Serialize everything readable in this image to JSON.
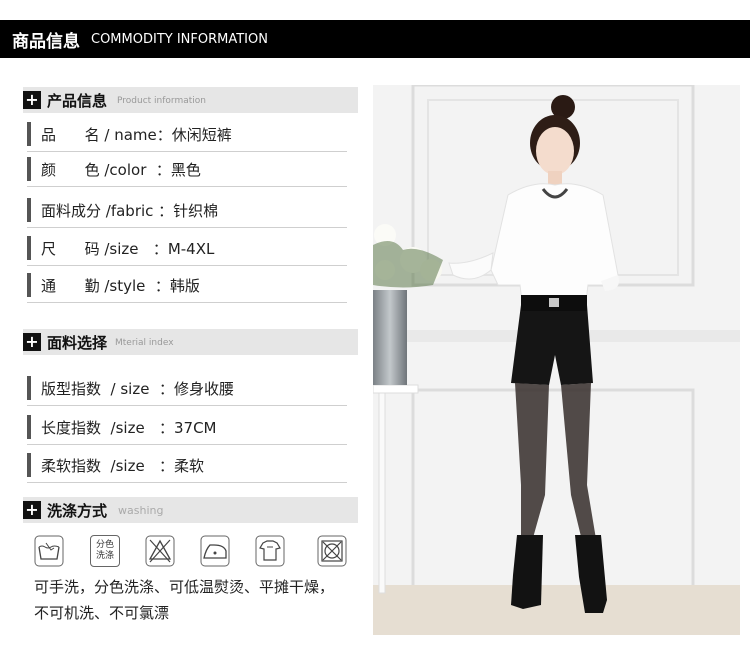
{
  "header": {
    "title_cn": "商品信息",
    "title_en": "COMMODITY INFORMATION"
  },
  "product_info": {
    "title": "产品信息",
    "subtitle": "Product information",
    "rows": [
      "品      名 / name：休闲短裤",
      "颜      色 /color  ：黑色",
      "面料成分 /fabric ：针织棉",
      "尺      码 /size   ：M-4XL",
      "通      勤 /style  ：韩版"
    ]
  },
  "material": {
    "title": "面料选择",
    "subtitle": "Mterial index",
    "rows": [
      "版型指数  / size  ：修身收腰",
      "长度指数  /size   ：37CM",
      "柔软指数  /size   ：柔软"
    ]
  },
  "washing": {
    "title": "洗涤方式",
    "subtitle": "washing",
    "icon_text_line1": "分色",
    "icon_text_line2": "洗涤",
    "desc_line1": "可手洗，分色洗涤、可低温熨烫、平摊干燥，",
    "desc_line2": "不可机洗、不可氯漂"
  },
  "icons": [
    "hand-wash-icon",
    "separate-wash-icon",
    "no-bleach-icon",
    "low-iron-icon",
    "dry-flat-icon",
    "no-tumble-icon"
  ]
}
